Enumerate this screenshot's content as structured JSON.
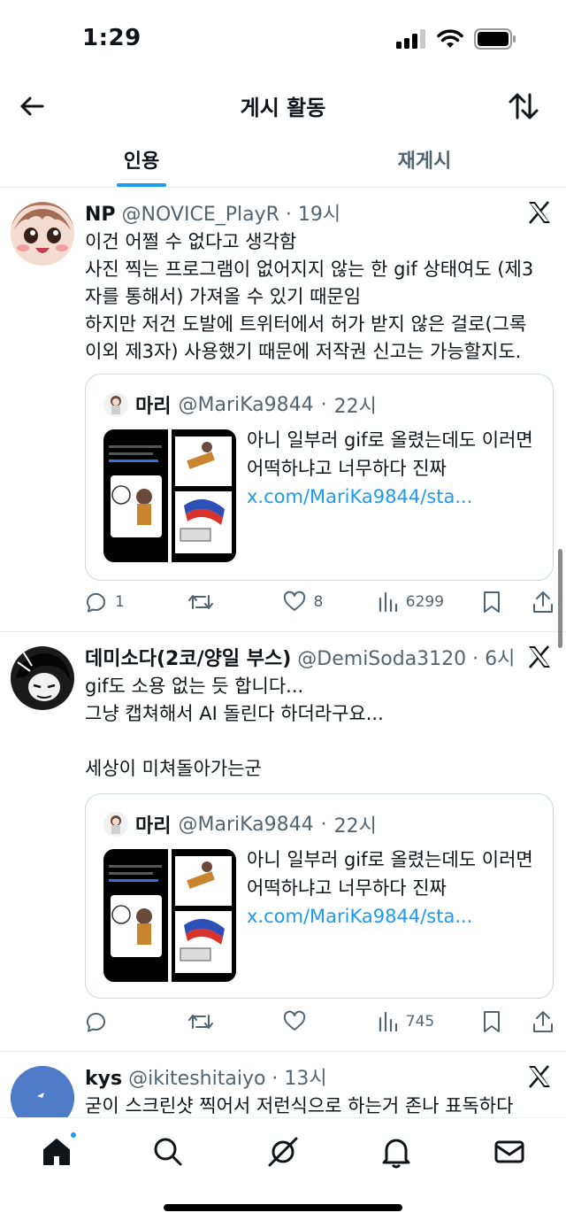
{
  "status_bar": {
    "time": "1:29"
  },
  "header": {
    "title": "게시 활동"
  },
  "tabs": [
    {
      "label": "인용",
      "active": true
    },
    {
      "label": "재게시",
      "active": false
    }
  ],
  "posts": [
    {
      "name": "NP",
      "handle": "@NOVICE_PlayR",
      "time": "19시",
      "text": "이건 어쩔 수 없다고 생각함\n사진 찍는 프로그램이 없어지지 않는 한 gif 상태여도 (제3자를 통해서) 가져올 수 있기 때문임\n하지만 저건 도발에 트위터에서 허가 받지 않은 걸로(그록 이외 제3자) 사용했기 때문에 저작권 신고는 가능할지도.",
      "quote": {
        "name": "마리",
        "handle": "@MariKa9844",
        "time": "22시",
        "text": "아니 일부러 gif로 올렸는데도 이러면 어떡하냐고 너무하다 진짜",
        "link": "x.com/MariKa9844/sta..."
      },
      "replies": "1",
      "reposts": "",
      "likes": "8",
      "views": "6299"
    },
    {
      "name": "데미소다(2코/양일 부스)",
      "handle": "@DemiSoda3120",
      "time": "6시",
      "text": "gif도 소용 없는 듯 합니다...\n그냥 캡쳐해서 AI 돌린다 하더라구요...\n\n세상이 미쳐돌아가는군",
      "quote": {
        "name": "마리",
        "handle": "@MariKa9844",
        "time": "22시",
        "text": "아니 일부러 gif로 올렸는데도 이러면 어떡하냐고 너무하다 진짜",
        "link": "x.com/MariKa9844/sta..."
      },
      "replies": "",
      "reposts": "",
      "likes": "",
      "views": "745"
    },
    {
      "name": "kys",
      "handle": "@ikiteshitaiyo",
      "time": "13시",
      "text": "굳이 스크린샷 찍어서 저런식으로 하는거 존나 표독하다"
    }
  ],
  "icons": {
    "back": "arrow-left-icon",
    "sort": "sort-icon",
    "x_logo": "x-logo-icon",
    "reply": "reply-icon",
    "repost": "repost-icon",
    "like": "heart-icon",
    "views": "views-icon",
    "bookmark": "bookmark-icon",
    "share": "share-icon",
    "nav": [
      "home-icon",
      "search-icon",
      "grok-icon",
      "bell-icon",
      "mail-icon"
    ]
  },
  "colors": {
    "accent": "#1d9bf0",
    "text": "#0f1419",
    "muted": "#536471"
  }
}
